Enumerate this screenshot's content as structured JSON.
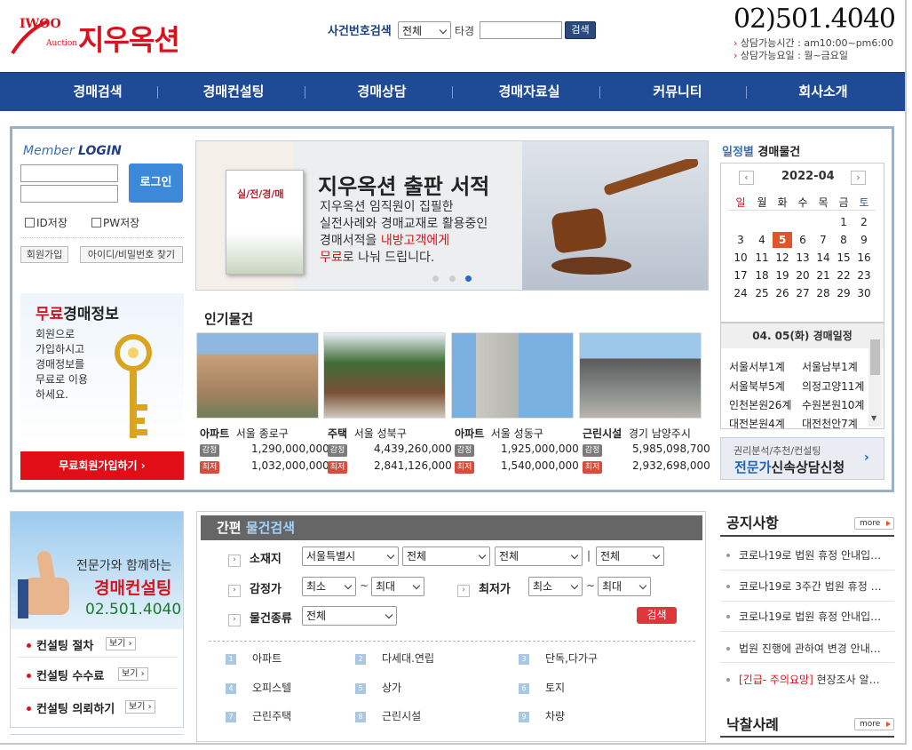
{
  "header": {
    "logo_iwoo": "IWOO",
    "logo_auction": "Auction",
    "logo_name": "지우옥션",
    "case_search_label": "사건번호검색",
    "case_select": "전체",
    "other_label": "타경",
    "search_btn": "검색",
    "phone": "02)501.4040",
    "hours1": "상담가능시간 : am10:00~pm6:00",
    "hours2": "상담가능요일 : 월~금요일"
  },
  "nav": [
    "경매검색",
    "경매컨설팅",
    "경매상담",
    "경매자료실",
    "커뮤니티",
    "회사소개"
  ],
  "login": {
    "title_member": "Member",
    "title_login": "LOGIN",
    "button": "로그인",
    "id_save": "ID저장",
    "pw_save": "PW저장",
    "join": "회원가입",
    "find": "아이디/비밀번호 찾기"
  },
  "free_info": {
    "title_red": "무료",
    "title_rest": "경매정보",
    "desc": [
      "회원으로",
      "가입하시고",
      "경매정보를",
      "무료로 이용",
      "하세요."
    ],
    "button": "무료회원가입하기 ›"
  },
  "banner": {
    "book_title": "실/전/경/매",
    "title": "지우옥션 출판 서적",
    "line1": "지우옥션 임직원이 집필한",
    "line2": "실전사례와 경매교재로 활용중인",
    "line3a": "경매서적을 ",
    "line3b": "내방고객에게",
    "line4a": "무료",
    "line4b": "로 나눠 드립니다.",
    "active_slide": 3
  },
  "popular": {
    "title": "인기물건",
    "items": [
      {
        "type": "아파트",
        "loc": "서울 종로구",
        "appraised_tag": "감정",
        "appraised": "1,290,000,000",
        "min_tag": "최저",
        "min": "1,032,000,000"
      },
      {
        "type": "주택",
        "loc": "서울 성북구",
        "appraised_tag": "감정",
        "appraised": "4,439,260,000",
        "min_tag": "최저",
        "min": "2,841,126,000"
      },
      {
        "type": "아파트",
        "loc": "서울 성동구",
        "appraised_tag": "감정",
        "appraised": "1,925,000,000",
        "min_tag": "최저",
        "min": "1,540,000,000"
      },
      {
        "type": "근린시설",
        "loc": "경기 남양주시",
        "appraised_tag": "감정",
        "appraised": "5,985,098,700",
        "min_tag": "최저",
        "min": "2,932,698,000"
      }
    ]
  },
  "schedule": {
    "title_blue": "일정별",
    "title_rest": " 경매물건",
    "month": "2022-04",
    "weekdays": [
      "일",
      "월",
      "화",
      "수",
      "목",
      "금",
      "토"
    ],
    "days": [
      "1",
      "2",
      "3",
      "4",
      "5",
      "6",
      "7",
      "8",
      "9",
      "10",
      "11",
      "12",
      "13",
      "14",
      "15",
      "16",
      "17",
      "18",
      "19",
      "20",
      "21",
      "22",
      "23",
      "24",
      "25",
      "26",
      "27",
      "28",
      "29",
      "30"
    ],
    "today": "5",
    "heading": "04. 05(화) 경매일정",
    "courts": [
      [
        "서울서부1계",
        "서울남부1계"
      ],
      [
        "서울북부5계",
        "의정고양11계"
      ],
      [
        "인천본원26계",
        "수원본원10계"
      ],
      [
        "대전본원4계",
        "대전천안7계"
      ]
    ],
    "consult_small": "권리분석/추천/컨설팅",
    "consult_blue": "전문가",
    "consult_rest": "신속상담신청"
  },
  "consulting": {
    "line1": "전문가와 함께하는",
    "line2": "경매컨설팅",
    "line3": "02.501.4040",
    "links": [
      {
        "label": "컨설팅 절차",
        "btn": "보기"
      },
      {
        "label": "컨설팅 수수료",
        "btn": "보기"
      },
      {
        "label": "컨설팅 의뢰하기",
        "btn": "보기"
      }
    ]
  },
  "quick_search": {
    "title_a": "간편",
    "title_b": " 물건검색",
    "location_label": "소재지",
    "location_selects": [
      "서울특별시",
      "전체",
      "전체",
      "전체"
    ],
    "appraisal_label": "감정가",
    "appraisal_min": "최소",
    "appraisal_max": "최대",
    "lowest_label": "최저가",
    "lowest_min": "최소",
    "lowest_max": "최대",
    "type_label": "물건종류",
    "type_select": "전체",
    "tilde": "~",
    "bar": "|",
    "search_btn": "검색",
    "categories": [
      {
        "num": "1",
        "label": "아파트"
      },
      {
        "num": "2",
        "label": "다세대.연립"
      },
      {
        "num": "3",
        "label": "단독,다가구"
      },
      {
        "num": "4",
        "label": "오피스텔"
      },
      {
        "num": "5",
        "label": "상가"
      },
      {
        "num": "6",
        "label": "토지"
      },
      {
        "num": "7",
        "label": "근린주택"
      },
      {
        "num": "8",
        "label": "근린시설"
      },
      {
        "num": "9",
        "label": "차량"
      }
    ]
  },
  "notice": {
    "title": "공지사항",
    "more": "more",
    "items": [
      "코로나19로 법원 휴정 안내입…",
      "코로나19로 3주간 법원 휴정 …",
      "코로나19로 법원 휴정 안내입…",
      "법원 진행에 관하여 변경 안내…"
    ],
    "urgent_red": "[긴급- 주의요망]",
    "urgent_rest": " 현장조사 알…",
    "cases_title": "낙찰사례",
    "cases_more": "more"
  }
}
